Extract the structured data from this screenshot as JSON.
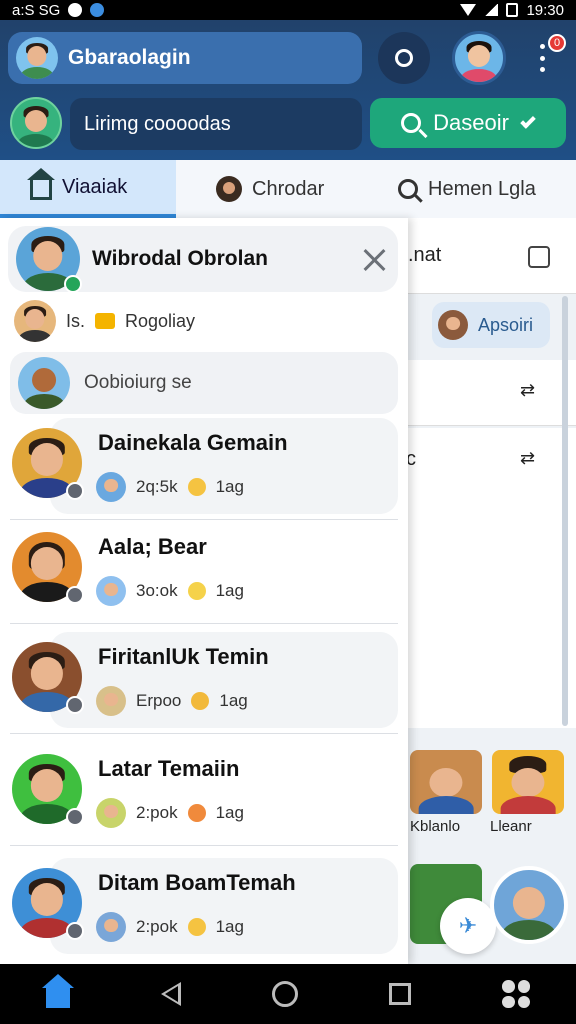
{
  "status_bar": {
    "time_left": "a:S SG",
    "time_right": "19:30"
  },
  "header": {
    "profile_name": "Gbaraolagin",
    "search_placeholder": "Lirimg coooodas",
    "discover_label": "Daseoir",
    "notification_count": "0"
  },
  "tabs": [
    {
      "label": "Viaaiak",
      "icon": "home-icon"
    },
    {
      "label": "Chrodar",
      "icon": "avatar"
    },
    {
      "label": "Hemen Lgla",
      "icon": "search-icon"
    }
  ],
  "drawer": {
    "selected_chat": "Wibrodal Obrolan",
    "sub_row_label": "Is.",
    "sub_row_badge": "Rogoliay",
    "sub_row_2": "Oobioiurg se",
    "contacts": [
      {
        "name": "Dainekala Gemain",
        "meta": "2q:5k",
        "tag": "1ag",
        "tag_color": "#f5c341"
      },
      {
        "name": "Aala; Bear",
        "meta": "3o:ok",
        "tag": "1ag",
        "tag_color": "#f5d24a"
      },
      {
        "name": "FiritanlUk Temin",
        "meta": "Erpoo",
        "tag": "1ag",
        "tag_color": "#f2b93b"
      },
      {
        "name": "Latar Temaiin",
        "meta": "2:pok",
        "tag": "1ag",
        "tag_color": "#f08a3c"
      },
      {
        "name": "Ditam BoamTemah",
        "meta": "2:pok",
        "tag": "1ag",
        "tag_color": "#f5c341"
      }
    ]
  },
  "background": {
    "row1_text": ".nat",
    "chip_label": "Apsoiri",
    "row3_text": "c",
    "caption_1": "Kblanlo",
    "caption_2": "Lleanr"
  }
}
